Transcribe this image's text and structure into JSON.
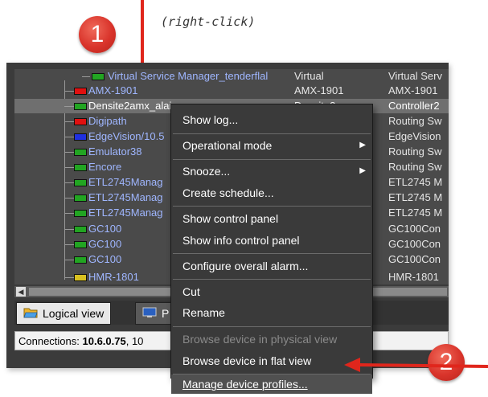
{
  "annotations": {
    "step1": "1",
    "step2": "2",
    "hint": "(right-click)"
  },
  "tree": {
    "rows": [
      {
        "name": "Virtual Service Manager_tenderflal",
        "type": "Virtual",
        "desc": "Virtual Serv",
        "led": "#22a522"
      },
      {
        "name": "AMX-1901",
        "type": "AMX-1901",
        "desc": "AMX-1901",
        "led": "#e01010"
      },
      {
        "name": "Densite2amx_alai",
        "type": "Densite2",
        "desc": "Controller2",
        "led": "#22a522",
        "selected": true
      },
      {
        "name": "Digipath",
        "type": "",
        "desc": "Routing Sw",
        "led": "#e01010"
      },
      {
        "name": "EdgeVision/10.5",
        "type": "",
        "desc": "EdgeVision",
        "led": "#2030e0"
      },
      {
        "name": "Emulator38",
        "type": "",
        "desc": "Routing Sw",
        "led": "#22a522"
      },
      {
        "name": "Encore",
        "type": "",
        "desc": "Routing Sw",
        "led": "#22a522"
      },
      {
        "name": "ETL2745Manag",
        "type": "",
        "desc": "ETL2745 M",
        "led": "#22a522"
      },
      {
        "name": "ETL2745Manag",
        "type": "",
        "desc": "ETL2745 M",
        "led": "#22a522"
      },
      {
        "name": "ETL2745Manag",
        "type": "",
        "desc": "ETL2745 M",
        "led": "#22a522"
      },
      {
        "name": "GC100",
        "type": "",
        "desc": "GC100Con",
        "led": "#22a522"
      },
      {
        "name": "GC100",
        "type": "",
        "desc": "GC100Con",
        "led": "#22a522"
      },
      {
        "name": "GC100",
        "type": "",
        "desc": "GC100Con",
        "led": "#22a522"
      },
      {
        "name": "HMR-1801",
        "type": "",
        "desc": "HMR-1801",
        "led": "#d8c020"
      }
    ]
  },
  "tabs": {
    "logical": "Logical view",
    "physical": "P"
  },
  "status": {
    "prefix": "Connections: ",
    "bold": "10.6.0.75",
    "suffix": ", 10"
  },
  "menu": {
    "items": [
      {
        "label": "Show log..."
      },
      {
        "label": "Operational mode"
      },
      {
        "label": "Snooze..."
      },
      {
        "label": "Create schedule..."
      },
      {
        "label": "Show control panel"
      },
      {
        "label": "Show info control panel"
      },
      {
        "label": "Configure overall alarm..."
      },
      {
        "label": "Cut"
      },
      {
        "label": "Rename"
      },
      {
        "label": "Browse device in physical view"
      },
      {
        "label": "Browse device in flat view"
      },
      {
        "label": "Manage device profiles..."
      }
    ]
  },
  "colors": {
    "accent_red": "#e0261c",
    "led_green": "#22a522",
    "led_red": "#e01010",
    "led_blue": "#2030e0",
    "led_yellow": "#d8c020"
  }
}
